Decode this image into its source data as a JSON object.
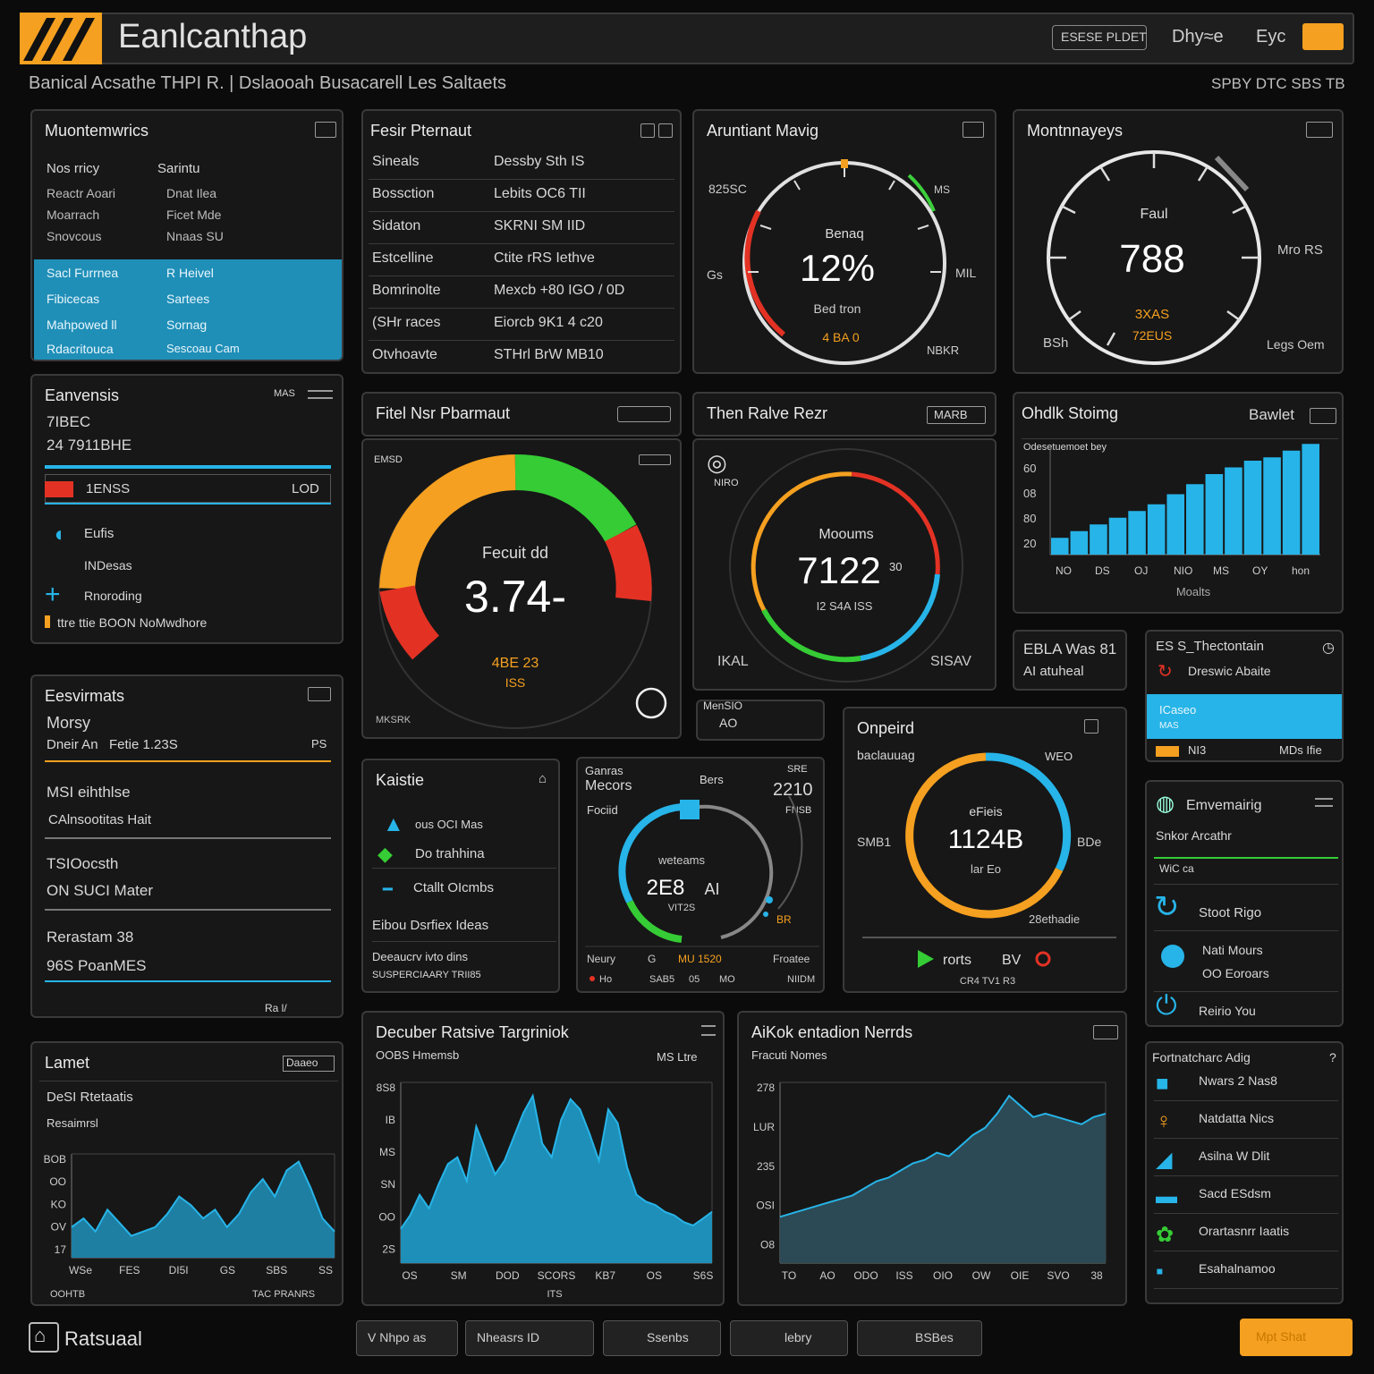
{
  "header": {
    "app_title": "Eanlcanthap",
    "subtitle": "Banical Acsathe THPI R. | Dslaooah Busacarell Les Saltaets",
    "btn_one": "ESESE PLDET",
    "btn_two": "Dhy≈e",
    "btn_three": "Eyc",
    "right_info": "SPBY DTC SBS TB",
    "colors": {
      "accent": "#f5a020",
      "blue": "#27b4e8"
    }
  },
  "p_monitor": {
    "title": "Muontemwrics",
    "rows": [
      [
        "Nos rricy",
        "Sarintu"
      ],
      [
        "Reactr Aoari",
        "Dnat Ilea"
      ],
      [
        "Moarrach",
        "Ficet Mde"
      ],
      [
        "Snovcous",
        "Nnaas SU"
      ]
    ],
    "hl_rows": [
      [
        "Sacl Furrnea",
        "R Heivel"
      ],
      [
        "Fibicecas",
        "Sartees"
      ],
      [
        "Mahpowed ll",
        "Sornag"
      ],
      [
        "Rdacritouca",
        "Sescoau Cam"
      ]
    ]
  },
  "p_fesir": {
    "title": "Fesir Pternaut",
    "rows": [
      [
        "Sineals",
        "Dessby Sth IS"
      ],
      [
        "Bossction",
        "Lebits OC6 TII"
      ],
      [
        "Sidaton",
        "SKRNI SM IID"
      ],
      [
        "Estcelline",
        "Ctite rRS Iethve"
      ],
      [
        "Bomrinolte",
        "Mexcb +80 IGO / 0D"
      ],
      [
        "(SHr races",
        "Eiorcb 9K1 4 c20"
      ],
      [
        "Otvhoavte",
        "STHrl BrW MB10"
      ]
    ]
  },
  "p_aruniant": {
    "title": "Aruntiant Mavig",
    "center_label": "Benaq",
    "value": "12%",
    "sub_label": "Bed tron",
    "sub_value": "4 BA 0",
    "left_label": "Gs",
    "right_label": "MIL",
    "top_left": "825SC",
    "top_right": "MS",
    "bottom_right": "NBKR"
  },
  "p_monitors2": {
    "title": "Montnnayeys",
    "center_label": "Faul",
    "value": "788",
    "sub_value_a": "3XAS",
    "sub_value_b": "72EUS",
    "left_label": "BSh",
    "right_label": "Mro RS",
    "bottom_right": "Legs Oem"
  },
  "p_eanvensis": {
    "title": "Eanvensis",
    "right_tag": "MAS",
    "line_one": "7IBEC",
    "line_two": "24 7911BHE",
    "bar_label": "1ENSS",
    "bar_right": "LOD",
    "items": [
      "Eufis",
      "INDesas",
      "Rnoroding"
    ],
    "footer": "ttre ttie BOON NoMwdhore"
  },
  "p_fitel": {
    "title": "Fitel Nsr Pbarmaut",
    "top_left": "EMSD",
    "label": "Fecuit dd",
    "value": "3.74-",
    "sub_a": "4BE 23",
    "sub_b": "ISS",
    "bottom_left": "MKSRK"
  },
  "p_thenralve": {
    "title": "Then Ralve Rezr",
    "right_tag": "MARB",
    "top_left": "NIRO",
    "label": "Mooums",
    "value": "7122",
    "value_sup": "30",
    "sub": "I2 S4A ISS",
    "bottom_left": "IKAL",
    "bottom_right": "SISAV"
  },
  "p_ohdlk": {
    "title": "Ohdlk Stoimg",
    "right_label": "Bawlet",
    "caption": "Odesetuemoet bey",
    "chart_data": {
      "type": "bar",
      "categories": [
        "NO",
        "DS",
        "OJ",
        "NIO",
        "MS",
        "OY",
        "hon"
      ],
      "values": [
        10,
        14,
        18,
        22,
        26,
        30,
        36,
        42,
        48,
        52,
        56,
        58,
        62,
        66
      ],
      "y_ticks": [
        "20",
        "80",
        "08",
        "60"
      ],
      "xlabel": "Moalts"
    }
  },
  "p_ebla": {
    "line_one": "EBLA Was 81",
    "line_two": "AI  atuheal"
  },
  "p_elsect": {
    "title": "ES S_Thectontain",
    "sub": "Dreswic Abaite",
    "hl_a": "ICaseo",
    "hl_b": "MAS",
    "footer_left": "NI3",
    "footer_right": "MDs Ifie"
  },
  "p_eesvirmats": {
    "title": "Eesvirmats",
    "line_one": "Morsy",
    "line_two_a": "Dneir An",
    "line_two_b": "Fetie 1.23S",
    "line_two_c": "PS",
    "block_one_a": "MSI eihthlse",
    "block_one_b": "CAlnsootitas Hait",
    "block_two_a": "TSIOocsth",
    "block_two_b": "ON SUCI Mater",
    "block_three_a": "Rerastam 38",
    "block_three_b": "96S PoanMES",
    "footer": "Ra l/"
  },
  "p_kaistie": {
    "title": "Kaistie",
    "items": [
      "ous OCI Mas",
      "Do trahhina",
      "Ctallt OIcmbs"
    ],
    "line_a": "Eibou Dsrfiex Ideas",
    "line_b": "Deeaucrv ivto dins",
    "line_c": "SUSPERCIAARY TRII85"
  },
  "p_sens": {
    "top_left_a": "Ganras",
    "top_left_b": "Mecors",
    "top_mid": "Bers",
    "top_right_a": "SRE",
    "top_right_b": "2210",
    "left_label": "Fociid",
    "right_label": "FNSB",
    "center_label": "weteams",
    "value": "2E8",
    "value_b": "AI",
    "sub": "VIT2S",
    "tag": "BR",
    "footer": [
      "Neury",
      "G",
      "MU 1520",
      "Froatee"
    ],
    "footer2": [
      "Ho",
      "SAB5",
      "05",
      "MO",
      "NIIDM"
    ]
  },
  "p_manrid": {
    "line_one": "MenSIO",
    "line_two": "AO"
  },
  "p_onpeird": {
    "title": "Onpeird",
    "sub": "baclauuag",
    "top_right": "WEO",
    "left_label": "SMB1",
    "right_label": "BDe",
    "center_label": "eFieis",
    "value": "1124B",
    "sub_value": "lar Eo",
    "footer_right": "28ethadie",
    "ctrl_label": "rorts",
    "ctrl_mid": "BV",
    "ctrl_sub": "CR4 TV1 R3"
  },
  "p_emvemaig": {
    "title": "Emvemairig",
    "sub": "Snkor Arcathr",
    "sub2": "WiC ca",
    "items": [
      "Stoot Rigo",
      "Nati Mours",
      "OO Eoroars",
      "Reirio You"
    ]
  },
  "p_lamet": {
    "title": "Lamet",
    "sub_a": "DeSI Rtetaatis",
    "sub_b": "Resaimrsl",
    "right_tag": "Daaeo",
    "y_ticks": [
      "BOB",
      "OO",
      "KO",
      "OV",
      "17"
    ],
    "x_ticks": [
      "WSe",
      "FES",
      "DI5I",
      "GS",
      "SBS",
      "SS"
    ],
    "footer_left": "OOHTB",
    "footer_right": "TAC PRANRS",
    "chart_data": {
      "type": "area",
      "values": [
        14,
        18,
        12,
        22,
        16,
        10,
        12,
        14,
        20,
        28,
        24,
        18,
        22,
        14,
        20,
        30,
        36,
        28,
        40,
        44,
        32,
        18,
        12
      ]
    }
  },
  "p_decuber": {
    "title": "Decuber Ratsive Targriniok",
    "sub": "OOBS Hmemsb",
    "right": "MS Ltre",
    "y_ticks": [
      "8S8",
      "IB",
      "MS",
      "SN",
      "OO",
      "2S"
    ],
    "x_ticks": [
      "OS",
      "SM",
      "DOD",
      "SCORS",
      "KB7",
      "OS",
      "S6S"
    ],
    "footer": "ITS",
    "chart_data": {
      "type": "area",
      "values": [
        20,
        28,
        40,
        32,
        46,
        58,
        62,
        48,
        80,
        66,
        52,
        60,
        74,
        88,
        98,
        70,
        62,
        84,
        96,
        90,
        76,
        60,
        90,
        82,
        56,
        40,
        36,
        34,
        30,
        28,
        24,
        22,
        26,
        30
      ]
    }
  },
  "p_aikok": {
    "title": "AiKok entadion Nerrds",
    "sub": "Fracuti Nomes",
    "y_ticks": [
      "278",
      "LUR",
      "235",
      "OSI",
      "O8"
    ],
    "x_ticks": [
      "TO",
      "AO",
      "ODO",
      "ISS",
      "OIO",
      "OW",
      "OIE",
      "SVO",
      "38"
    ],
    "chart_data": {
      "type": "area",
      "values": [
        26,
        28,
        30,
        32,
        34,
        36,
        38,
        42,
        46,
        48,
        52,
        56,
        58,
        62,
        60,
        66,
        72,
        76,
        84,
        94,
        88,
        82,
        84,
        82,
        80,
        78,
        82,
        84
      ]
    }
  },
  "p_fortnat": {
    "title": "Fortnatcharc Adig",
    "items": [
      "Nwars 2 Nas8",
      "Natdatta Nics",
      "Asilna W Dlit",
      "Sacd ESdsm",
      "Orartasnrr Iaatis",
      "Esahalnamoo"
    ]
  },
  "footer": {
    "brand": "Ratsuaal",
    "btns": [
      "V Nhpo as",
      "Nheasrs ID",
      "Ssenbs",
      "lebry",
      "BSBes"
    ],
    "action": "Mpt Shat"
  }
}
